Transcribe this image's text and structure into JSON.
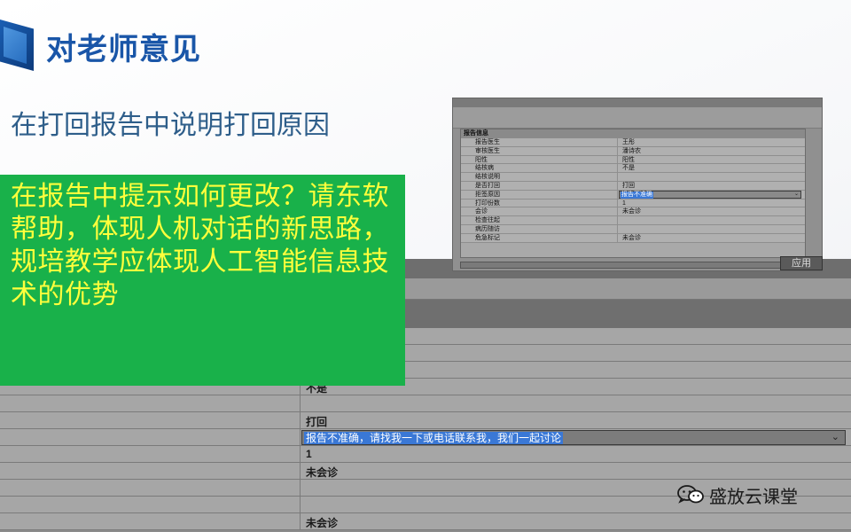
{
  "slide": {
    "title": "对老师意见",
    "subtitle": "在打回报告中说明打回原因",
    "callout_text": "在报告中提示如何更改？请东软帮助，体现人机对话的新思路，规培教学应体现人工智能信息技术的优势",
    "callout_bg": "#19b14a",
    "callout_text_color": "#ffff3c",
    "title_color": "#1a56a8"
  },
  "small_screenshot": {
    "section_header": "报告信息",
    "rows": [
      {
        "label": "报告医生",
        "value": "王彤"
      },
      {
        "label": "审核医生",
        "value": "潘诗农"
      },
      {
        "label": "阳性",
        "value": "阳性"
      },
      {
        "label": "结核病",
        "value": "不是"
      },
      {
        "label": "结核说明",
        "value": ""
      },
      {
        "label": "是否打回",
        "value": "打回"
      },
      {
        "label": "拒签原因",
        "value": "报告不准确",
        "is_select": true
      },
      {
        "label": "打印份数",
        "value": "1"
      },
      {
        "label": "会诊",
        "value": "未会诊"
      },
      {
        "label": "检查往起",
        "value": ""
      },
      {
        "label": "病历随访",
        "value": ""
      },
      {
        "label": "危急标记",
        "value": "未会诊"
      }
    ],
    "apply_button": "应用"
  },
  "large_screenshot": {
    "rows": [
      {
        "value": ""
      },
      {
        "value": ""
      },
      {
        "value": ""
      },
      {
        "value": "不是"
      },
      {
        "value": ""
      },
      {
        "value": "打回"
      },
      {
        "value": "报告不准确，请找我一下或电话联系我，我们一起讨论",
        "is_select": true
      },
      {
        "value": "1"
      },
      {
        "value": "未会诊"
      },
      {
        "value": ""
      },
      {
        "value": ""
      },
      {
        "value": "未会诊"
      }
    ]
  },
  "watermark": {
    "text": "盛放云课堂",
    "icon": "wechat-icon"
  }
}
